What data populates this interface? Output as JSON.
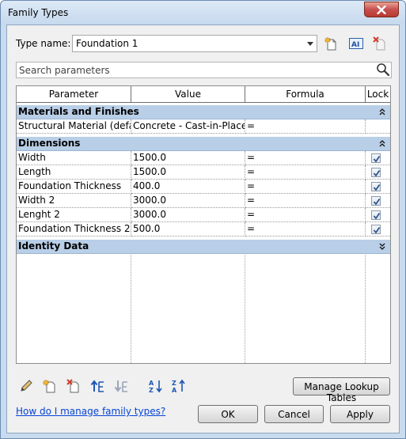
{
  "window": {
    "title": "Family Types"
  },
  "typename": {
    "label": "Type name:",
    "value": "Foundation 1"
  },
  "search": {
    "placeholder": "Search parameters"
  },
  "columns": [
    "Parameter",
    "Value",
    "Formula",
    "Lock"
  ],
  "groups": {
    "materials": {
      "label": "Materials and Finishes",
      "rows": [
        {
          "parameter": "Structural Material (default)",
          "value": "Concrete - Cast-in-Place",
          "formula": "="
        }
      ]
    },
    "dimensions": {
      "label": "Dimensions",
      "rows": [
        {
          "parameter": "Width",
          "value": "1500.0",
          "formula": "=",
          "locked": true
        },
        {
          "parameter": "Length",
          "value": "1500.0",
          "formula": "=",
          "locked": true
        },
        {
          "parameter": "Foundation Thickness",
          "value": "400.0",
          "formula": "=",
          "locked": true
        },
        {
          "parameter": "Width 2",
          "value": "3000.0",
          "formula": "=",
          "locked": true
        },
        {
          "parameter": "Lenght 2",
          "value": "3000.0",
          "formula": "=",
          "locked": true
        },
        {
          "parameter": "Foundation Thickness 2",
          "value": "500.0",
          "formula": "=",
          "locked": true
        }
      ]
    },
    "identity": {
      "label": "Identity Data"
    }
  },
  "buttons": {
    "manage_lookup": "Manage Lookup Tables",
    "ok": "OK",
    "cancel": "Cancel",
    "apply": "Apply"
  },
  "help_link": "How do I manage family types?"
}
